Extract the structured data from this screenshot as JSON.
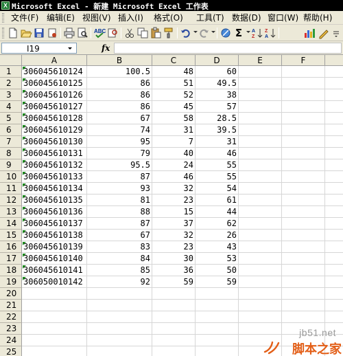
{
  "window": {
    "title": "Microsoft Excel - 新建 Microsoft Excel 工作表"
  },
  "menu": [
    {
      "label": "文件(F)"
    },
    {
      "label": "编辑(E)"
    },
    {
      "label": "视图(V)"
    },
    {
      "label": "插入(I)"
    },
    {
      "label": "格式(O)"
    },
    {
      "label": "工具(T)"
    },
    {
      "label": "数据(D)"
    },
    {
      "label": "窗口(W)"
    },
    {
      "label": "帮助(H)"
    }
  ],
  "toolbar": {
    "icons": [
      "new-icon",
      "open-icon",
      "save-icon",
      "permission-icon",
      "print-icon",
      "print-preview-icon",
      "spelling-icon",
      "research-icon",
      "cut-icon",
      "copy-icon",
      "paste-icon",
      "format-painter-icon",
      "undo-icon",
      "redo-icon",
      "hyperlink-icon",
      "autosum-icon",
      "sort-ascending-icon",
      "sort-descending-icon",
      "chart-wizard-icon",
      "drawing-icon"
    ],
    "autosum_glyph": "Σ"
  },
  "formula_bar": {
    "name_box": "I19",
    "fx_label": "fx",
    "formula": ""
  },
  "sheet": {
    "columns": [
      "A",
      "B",
      "C",
      "D",
      "E",
      "F",
      "G"
    ],
    "row_numbers": [
      "1",
      "2",
      "3",
      "4",
      "5",
      "6",
      "7",
      "8",
      "9",
      "10",
      "11",
      "12",
      "13",
      "14",
      "15",
      "16",
      "17",
      "18",
      "19",
      "20",
      "21",
      "22",
      "23",
      "24",
      "25"
    ],
    "rows": [
      [
        "306045610124",
        "100.5",
        "48",
        "60"
      ],
      [
        "306045610125",
        "86",
        "51",
        "49.5"
      ],
      [
        "306045610126",
        "86",
        "52",
        "38"
      ],
      [
        "306045610127",
        "86",
        "45",
        "57"
      ],
      [
        "306045610128",
        "67",
        "58",
        "28.5"
      ],
      [
        "306045610129",
        "74",
        "31",
        "39.5"
      ],
      [
        "306045610130",
        "95",
        "7",
        "31"
      ],
      [
        "306045610131",
        "79",
        "40",
        "46"
      ],
      [
        "306045610132",
        "95.5",
        "24",
        "55"
      ],
      [
        "306045610133",
        "87",
        "46",
        "55"
      ],
      [
        "306045610134",
        "93",
        "32",
        "54"
      ],
      [
        "306045610135",
        "81",
        "23",
        "61"
      ],
      [
        "306045610136",
        "88",
        "15",
        "44"
      ],
      [
        "306045610137",
        "87",
        "37",
        "62"
      ],
      [
        "306045610138",
        "67",
        "32",
        "26"
      ],
      [
        "306045610139",
        "83",
        "23",
        "43"
      ],
      [
        "306045610140",
        "84",
        "30",
        "53"
      ],
      [
        "306045610141",
        "85",
        "36",
        "50"
      ],
      [
        "306050010142",
        "92",
        "59",
        "59"
      ]
    ],
    "error_indicator_color": "#1a8a1a"
  },
  "watermark": {
    "site": "jb51.net",
    "brand": "脚本之家",
    "brand_color": "#e35f18"
  }
}
